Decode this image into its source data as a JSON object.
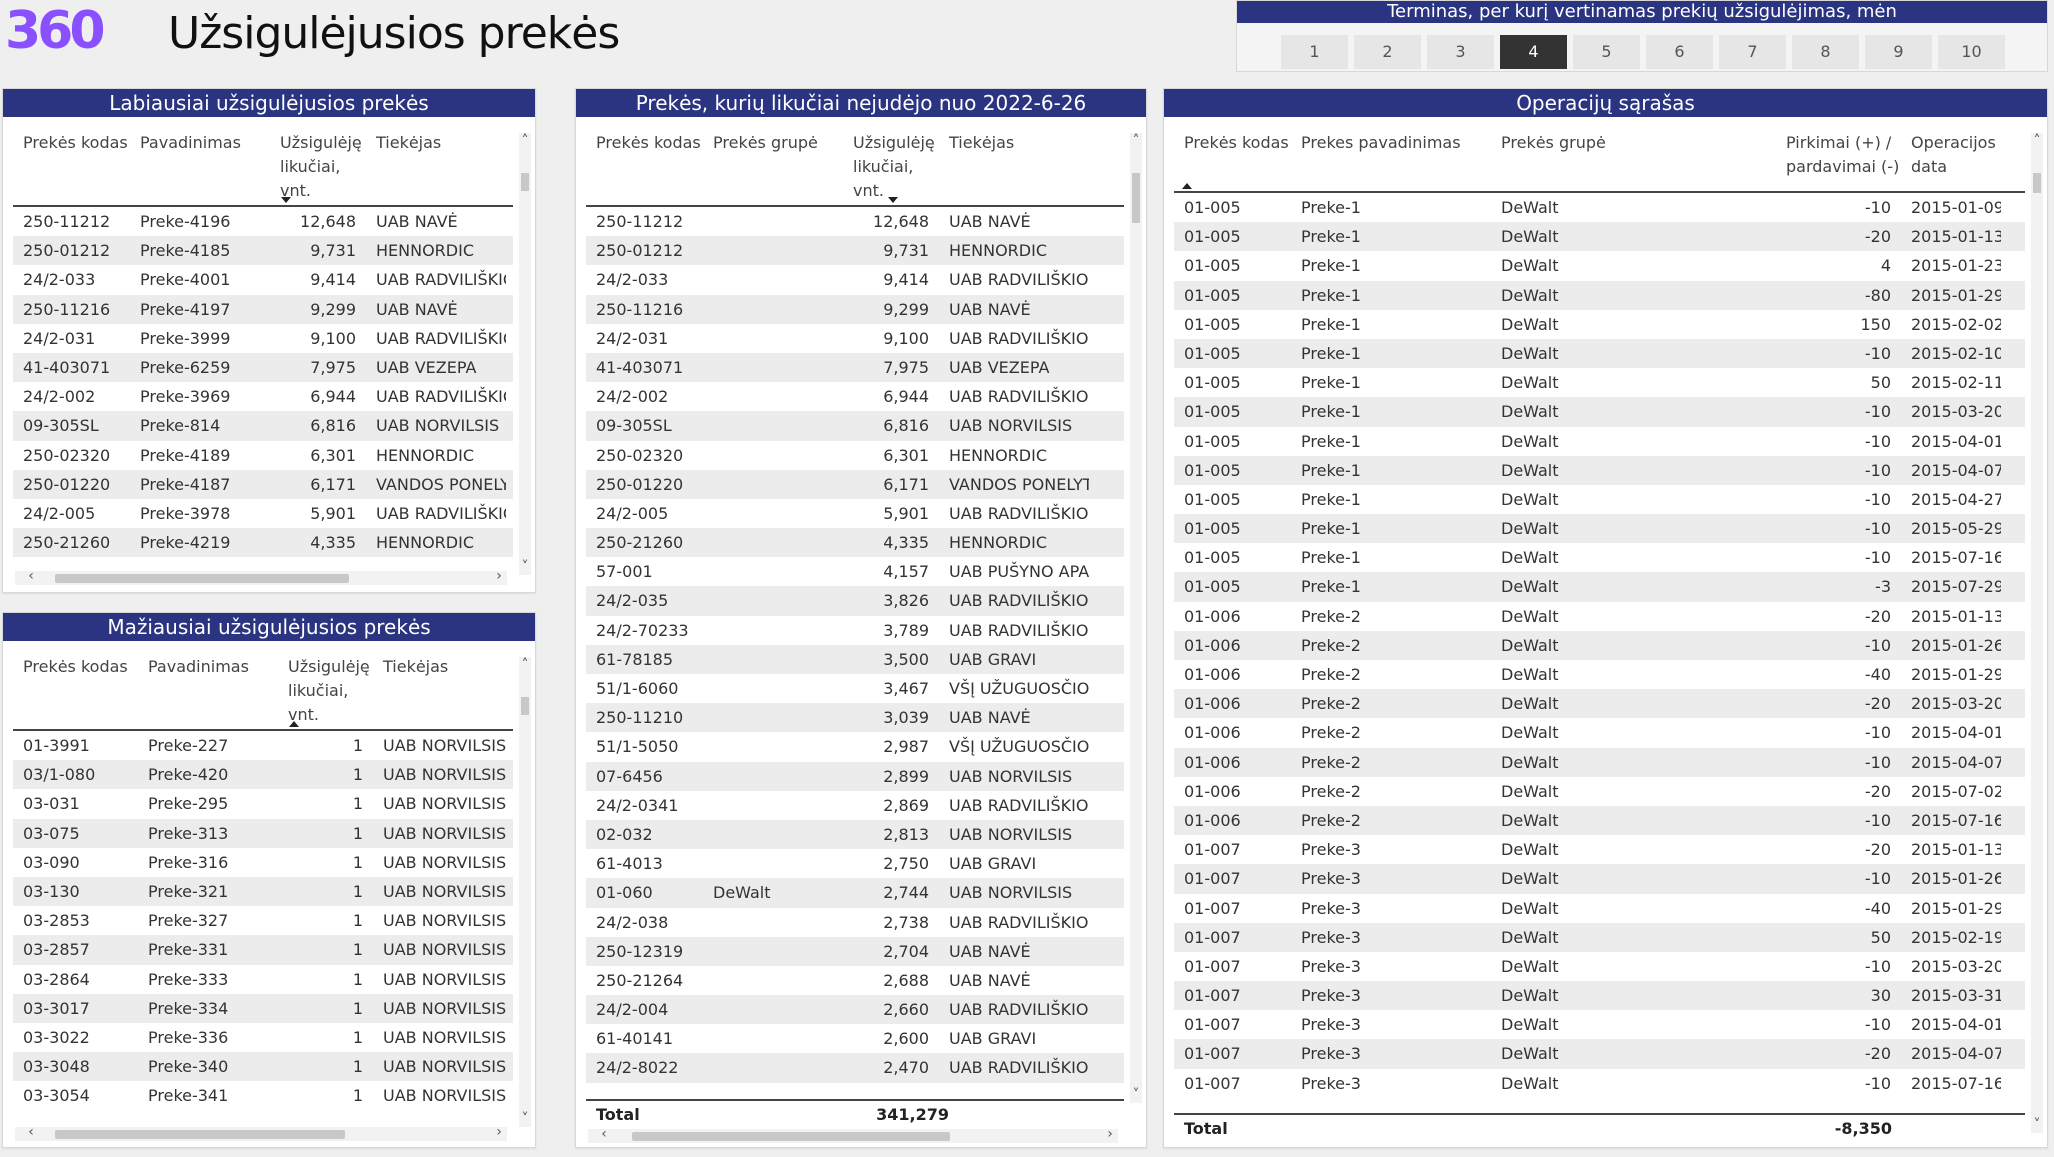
{
  "header": {
    "logo": "360",
    "title": "Užsigulėjusios prekės"
  },
  "slicer": {
    "title": "Terminas, per kurį vertinamas prekių užsigulėjimas, mėn",
    "options": [
      "1",
      "2",
      "3",
      "4",
      "5",
      "6",
      "7",
      "8",
      "9",
      "10"
    ],
    "selected": "4"
  },
  "most": {
    "title": "Labiausiai užsigulėjusios prekės",
    "headers": [
      "Prekės kodas",
      "Pavadinimas",
      "Užsigulėję likučiai, vnt.",
      "Tiekėjas"
    ],
    "rows": [
      [
        "250-11212",
        "Preke-4196",
        "12,648",
        "UAB NAVĖ"
      ],
      [
        "250-01212",
        "Preke-4185",
        "9,731",
        "HENNORDIC"
      ],
      [
        "24/2-033",
        "Preke-4001",
        "9,414",
        "UAB RADVILIŠKIO"
      ],
      [
        "250-11216",
        "Preke-4197",
        "9,299",
        "UAB NAVĖ"
      ],
      [
        "24/2-031",
        "Preke-3999",
        "9,100",
        "UAB RADVILIŠKIO"
      ],
      [
        "41-403071",
        "Preke-6259",
        "7,975",
        "UAB VEZEPA"
      ],
      [
        "24/2-002",
        "Preke-3969",
        "6,944",
        "UAB RADVILIŠKIO"
      ],
      [
        "09-305SL",
        "Preke-814",
        "6,816",
        "UAB NORVILSIS"
      ],
      [
        "250-02320",
        "Preke-4189",
        "6,301",
        "HENNORDIC"
      ],
      [
        "250-01220",
        "Preke-4187",
        "6,171",
        "VANDOS PONELYT"
      ],
      [
        "24/2-005",
        "Preke-3978",
        "5,901",
        "UAB RADVILIŠKIO"
      ],
      [
        "250-21260",
        "Preke-4219",
        "4,335",
        "HENNORDIC"
      ]
    ]
  },
  "least": {
    "title": "Mažiausiai užsigulėjusios prekės",
    "headers": [
      "Prekės kodas",
      "Pavadinimas",
      "Užsigulėję likučiai, vnt.",
      "Tiekėjas"
    ],
    "rows": [
      [
        "01-3991",
        "Preke-227",
        "1",
        "UAB NORVILSIS"
      ],
      [
        "03/1-080",
        "Preke-420",
        "1",
        "UAB NORVILSIS"
      ],
      [
        "03-031",
        "Preke-295",
        "1",
        "UAB NORVILSIS"
      ],
      [
        "03-075",
        "Preke-313",
        "1",
        "UAB NORVILSIS"
      ],
      [
        "03-090",
        "Preke-316",
        "1",
        "UAB NORVILSIS"
      ],
      [
        "03-130",
        "Preke-321",
        "1",
        "UAB NORVILSIS"
      ],
      [
        "03-2853",
        "Preke-327",
        "1",
        "UAB NORVILSIS"
      ],
      [
        "03-2857",
        "Preke-331",
        "1",
        "UAB NORVILSIS"
      ],
      [
        "03-2864",
        "Preke-333",
        "1",
        "UAB NORVILSIS"
      ],
      [
        "03-3017",
        "Preke-334",
        "1",
        "UAB NORVILSIS"
      ],
      [
        "03-3022",
        "Preke-336",
        "1",
        "UAB NORVILSIS"
      ],
      [
        "03-3048",
        "Preke-340",
        "1",
        "UAB NORVILSIS"
      ],
      [
        "03-3054",
        "Preke-341",
        "1",
        "UAB NORVILSIS"
      ]
    ]
  },
  "stale": {
    "title": "Prekės, kurių likučiai nejudėjo nuo 2022-6-26",
    "headers": [
      "Prekės kodas",
      "Prekės grupė",
      "Užsigulėję likučiai, vnt.",
      "Tiekėjas"
    ],
    "rows": [
      [
        "250-11212",
        "",
        "12,648",
        "UAB NAVĖ"
      ],
      [
        "250-01212",
        "",
        "9,731",
        "HENNORDIC"
      ],
      [
        "24/2-033",
        "",
        "9,414",
        "UAB RADVILIŠKIO A"
      ],
      [
        "250-11216",
        "",
        "9,299",
        "UAB NAVĖ"
      ],
      [
        "24/2-031",
        "",
        "9,100",
        "UAB RADVILIŠKIO A"
      ],
      [
        "41-403071",
        "",
        "7,975",
        "UAB VEZEPA"
      ],
      [
        "24/2-002",
        "",
        "6,944",
        "UAB RADVILIŠKIO A"
      ],
      [
        "09-305SL",
        "",
        "6,816",
        "UAB NORVILSIS"
      ],
      [
        "250-02320",
        "",
        "6,301",
        "HENNORDIC"
      ],
      [
        "250-01220",
        "",
        "6,171",
        "VANDOS PONELYT"
      ],
      [
        "24/2-005",
        "",
        "5,901",
        "UAB RADVILIŠKIO A"
      ],
      [
        "250-21260",
        "",
        "4,335",
        "HENNORDIC"
      ],
      [
        "57-001",
        "",
        "4,157",
        "UAB PUŠYNO APAF"
      ],
      [
        "24/2-035",
        "",
        "3,826",
        "UAB RADVILIŠKIO A"
      ],
      [
        "24/2-70233",
        "",
        "3,789",
        "UAB RADVILIŠKIO A"
      ],
      [
        "61-78185",
        "",
        "3,500",
        "UAB GRAVI"
      ],
      [
        "51/1-6060",
        "",
        "3,467",
        "VŠĮ UŽUGUOSČIO"
      ],
      [
        "250-11210",
        "",
        "3,039",
        "UAB NAVĖ"
      ],
      [
        "51/1-5050",
        "",
        "2,987",
        "VŠĮ UŽUGUOSČIO"
      ],
      [
        "07-6456",
        "",
        "2,899",
        "UAB NORVILSIS"
      ],
      [
        "24/2-0341",
        "",
        "2,869",
        "UAB RADVILIŠKIO A"
      ],
      [
        "02-032",
        "",
        "2,813",
        "UAB NORVILSIS"
      ],
      [
        "61-4013",
        "",
        "2,750",
        "UAB GRAVI"
      ],
      [
        "01-060",
        "DeWalt",
        "2,744",
        "UAB NORVILSIS"
      ],
      [
        "24/2-038",
        "",
        "2,738",
        "UAB RADVILIŠKIO A"
      ],
      [
        "250-12319",
        "",
        "2,704",
        "UAB NAVĖ"
      ],
      [
        "250-21264",
        "",
        "2,688",
        "UAB NAVĖ"
      ],
      [
        "24/2-004",
        "",
        "2,660",
        "UAB RADVILIŠKIO A"
      ],
      [
        "61-40141",
        "",
        "2,600",
        "UAB GRAVI"
      ],
      [
        "24/2-8022",
        "",
        "2,470",
        "UAB RADVILIŠKIO A"
      ]
    ],
    "total_label": "Total",
    "total_value": "341,279"
  },
  "ops": {
    "title": "Operacijų sąrašas",
    "headers": [
      "Prekės kodas",
      "Prekes pavadinimas",
      "Prekės grupė",
      "Pirkimai (+) / pardavimai (-)",
      "Operacijos data"
    ],
    "rows": [
      [
        "01-005",
        "Preke-1",
        "DeWalt",
        "-10",
        "2015-01-09"
      ],
      [
        "01-005",
        "Preke-1",
        "DeWalt",
        "-20",
        "2015-01-13"
      ],
      [
        "01-005",
        "Preke-1",
        "DeWalt",
        "4",
        "2015-01-23"
      ],
      [
        "01-005",
        "Preke-1",
        "DeWalt",
        "-80",
        "2015-01-29"
      ],
      [
        "01-005",
        "Preke-1",
        "DeWalt",
        "150",
        "2015-02-02"
      ],
      [
        "01-005",
        "Preke-1",
        "DeWalt",
        "-10",
        "2015-02-10"
      ],
      [
        "01-005",
        "Preke-1",
        "DeWalt",
        "50",
        "2015-02-11"
      ],
      [
        "01-005",
        "Preke-1",
        "DeWalt",
        "-10",
        "2015-03-20"
      ],
      [
        "01-005",
        "Preke-1",
        "DeWalt",
        "-10",
        "2015-04-01"
      ],
      [
        "01-005",
        "Preke-1",
        "DeWalt",
        "-10",
        "2015-04-07"
      ],
      [
        "01-005",
        "Preke-1",
        "DeWalt",
        "-10",
        "2015-04-27"
      ],
      [
        "01-005",
        "Preke-1",
        "DeWalt",
        "-10",
        "2015-05-29"
      ],
      [
        "01-005",
        "Preke-1",
        "DeWalt",
        "-10",
        "2015-07-16"
      ],
      [
        "01-005",
        "Preke-1",
        "DeWalt",
        "-3",
        "2015-07-29"
      ],
      [
        "01-006",
        "Preke-2",
        "DeWalt",
        "-20",
        "2015-01-13"
      ],
      [
        "01-006",
        "Preke-2",
        "DeWalt",
        "-10",
        "2015-01-26"
      ],
      [
        "01-006",
        "Preke-2",
        "DeWalt",
        "-40",
        "2015-01-29"
      ],
      [
        "01-006",
        "Preke-2",
        "DeWalt",
        "-20",
        "2015-03-20"
      ],
      [
        "01-006",
        "Preke-2",
        "DeWalt",
        "-10",
        "2015-04-01"
      ],
      [
        "01-006",
        "Preke-2",
        "DeWalt",
        "-10",
        "2015-04-07"
      ],
      [
        "01-006",
        "Preke-2",
        "DeWalt",
        "-20",
        "2015-07-02"
      ],
      [
        "01-006",
        "Preke-2",
        "DeWalt",
        "-10",
        "2015-07-16"
      ],
      [
        "01-007",
        "Preke-3",
        "DeWalt",
        "-20",
        "2015-01-13"
      ],
      [
        "01-007",
        "Preke-3",
        "DeWalt",
        "-10",
        "2015-01-26"
      ],
      [
        "01-007",
        "Preke-3",
        "DeWalt",
        "-40",
        "2015-01-29"
      ],
      [
        "01-007",
        "Preke-3",
        "DeWalt",
        "50",
        "2015-02-19"
      ],
      [
        "01-007",
        "Preke-3",
        "DeWalt",
        "-10",
        "2015-03-20"
      ],
      [
        "01-007",
        "Preke-3",
        "DeWalt",
        "30",
        "2015-03-31"
      ],
      [
        "01-007",
        "Preke-3",
        "DeWalt",
        "-10",
        "2015-04-01"
      ],
      [
        "01-007",
        "Preke-3",
        "DeWalt",
        "-20",
        "2015-04-07"
      ],
      [
        "01-007",
        "Preke-3",
        "DeWalt",
        "-10",
        "2015-07-16"
      ]
    ],
    "total_label": "Total",
    "total_value": "-8,350"
  },
  "colors": {
    "accent": "#2a3480",
    "logo": "#8a4fff",
    "selected": "#333333"
  },
  "icons": {
    "sort_desc": "sort-descending-icon",
    "sort_asc": "sort-ascending-icon"
  }
}
